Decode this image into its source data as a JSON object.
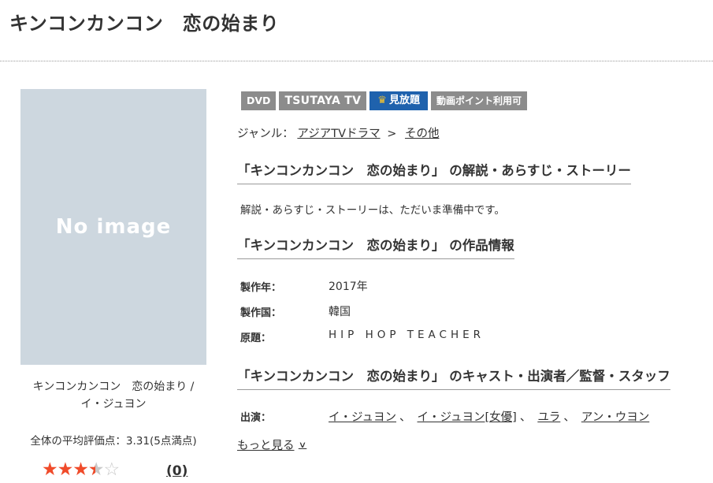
{
  "page": {
    "title": "キンコンカンコン　恋の始まり"
  },
  "poster": {
    "placeholder_text": "No image"
  },
  "caption": "キンコンカンコン　恋の始まり /\nイ・ジュヨン",
  "rating": {
    "summary_text": "全体の平均評価点：3.31(5点満点)",
    "stars_value": 3.31,
    "stars_max": 5,
    "review_count": "(0)"
  },
  "badges": {
    "dvd": "DVD",
    "tsutaya_tv": "TSUTAYA TV",
    "mihoudai": "見放題",
    "point": "動画ポイント利用可"
  },
  "genre": {
    "label": "ジャンル：",
    "items": [
      "アジアTVドラマ",
      "その他"
    ],
    "separator": ">"
  },
  "sections": {
    "synopsis_heading": "「キンコンカンコン　恋の始まり」 の解説・あらすじ・ストーリー",
    "synopsis_text": "解説・あらすじ・ストーリーは、ただいま準備中です。",
    "info_heading": "「キンコンカンコン　恋の始まり」 の作品情報",
    "cast_heading": "「キンコンカンコン　恋の始まり」 のキャスト・出演者／監督・スタッフ"
  },
  "info": {
    "year_label": "製作年：",
    "year_value": "2017年",
    "country_label": "製作国：",
    "country_value": "韓国",
    "original_label": "原題：",
    "original_value": "HIP HOP TEACHER"
  },
  "cast": {
    "label": "出演：",
    "names": [
      "イ・ジュヨン",
      "イ・ジュヨン[女優]",
      "ユラ",
      "アン・ウヨン"
    ],
    "comma": "、"
  },
  "more_link": "もっと見る"
}
